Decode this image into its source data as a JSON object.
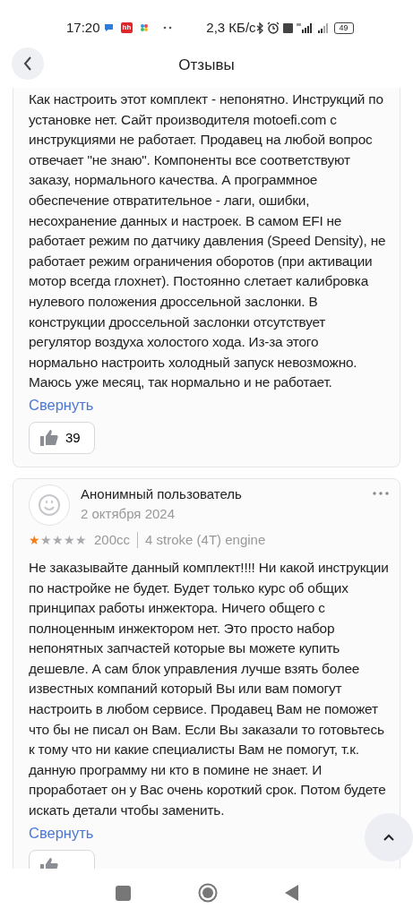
{
  "status_bar": {
    "time": "17:20",
    "app_label": "hh",
    "speed": "2,3 КБ/с",
    "battery": "49"
  },
  "header": {
    "title": "Отзывы"
  },
  "reviews": [
    {
      "text": "Как настроить этот комплект - непонятно. Инструкций по установке нет. Сайт производителя motoefi.com с инструкциями не работает. Продавец на любой вопрос отвечает \"не знаю\".  Компоненты все соответствуют заказу, нормального качества. А программное обеспечение отвратительное - лаги, ошибки, несохранение данных и настроек. В самом EFI не работает режим по датчику давления (Speed Density), не работает режим ограничения оборотов (при активации мотор всегда глохнет). Постоянно слетает калибровка нулевого положения дроссельной заслонки. В конструкции дроссельной заслонки отсутствует регулятор воздуха холостого хода. Из-за этого нормально настроить холодный запуск невозможно. Маюсь уже месяц, так нормально и не работает.",
      "collapse_link": "Свернуть",
      "likes": "39"
    },
    {
      "author": "Анонимный пользователь",
      "date": "2 октября 2024",
      "stars": 1,
      "variant": [
        "200cc",
        "4 stroke (4T) engine"
      ],
      "text": "Не заказывайте данный комплект!!!! Ни  какой инструкции по настройке не будет. Будет только курс об общих принципах работы инжектора. Ничего общего с полноценным инжектором нет. Это просто набор непонятных запчастей которые вы можете купить дешевле. А сам блок управления лучше взять более известных компаний который Вы или вам помогут настроить в любом сервисе. Продавец Вам не поможет что бы не писал он Вам. Если Вы заказали то готовьтесь к тому что ни какие специалисты Вам не помогут, т.к. данную программу ни кто в помине не знает. И проработает он у Вас очень короткий срок. Потом будете искать детали чтобы заменить.",
      "collapse_link": "Свернуть"
    }
  ]
}
